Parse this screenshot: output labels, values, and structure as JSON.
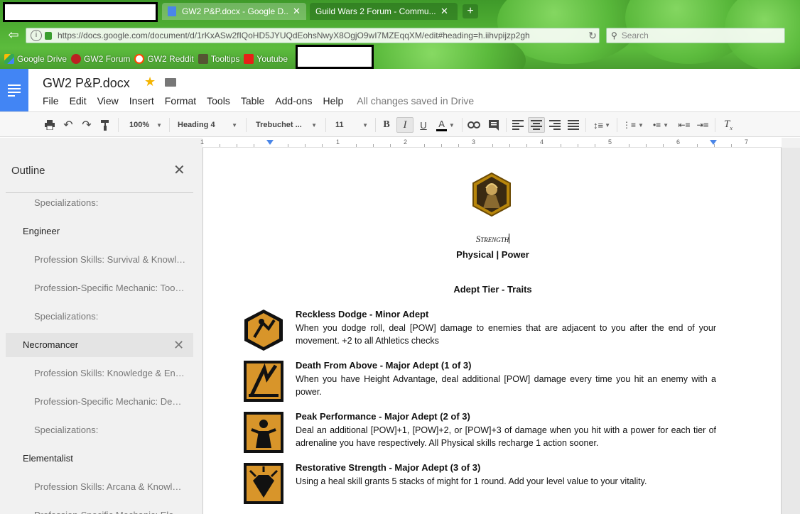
{
  "browser": {
    "tabs": [
      {
        "title": "GW2 P&P.docx - Google D...",
        "active": true
      },
      {
        "title": "Guild Wars 2 Forum - Commu...",
        "active": false
      }
    ],
    "new_tab_label": "+",
    "url": "https://docs.google.com/document/d/1rKxASw2fIQoHD5JYUQdEohsNwyX8OgjO9wI7MZEqqXM/edit#heading=h.iihvpijzp2gh",
    "search_placeholder": "Search",
    "bookmarks": [
      "Google Drive",
      "GW2 Forum",
      "GW2 Reddit",
      "Tooltips",
      "Youtube"
    ]
  },
  "docs": {
    "title": "GW2 P&P.docx",
    "menu": [
      "File",
      "Edit",
      "View",
      "Insert",
      "Format",
      "Tools",
      "Table",
      "Add-ons",
      "Help"
    ],
    "save_status": "All changes saved in Drive",
    "toolbar": {
      "zoom": "100%",
      "style": "Heading 4",
      "font": "Trebuchet ...",
      "size": "11"
    },
    "ruler_numbers": [
      "1",
      "1",
      "2",
      "3",
      "4",
      "5",
      "6",
      "7"
    ]
  },
  "outline": {
    "heading": "Outline",
    "items": [
      {
        "level": 2,
        "label": "Specializations:"
      },
      {
        "level": 1,
        "label": "Engineer"
      },
      {
        "level": 2,
        "label": "Profession Skills: Survival & Knowledge"
      },
      {
        "level": 2,
        "label": "Profession-Specific Mechanic: Toolbelt"
      },
      {
        "level": 2,
        "label": "Specializations:"
      },
      {
        "level": 1,
        "label": "Necromancer",
        "active": true
      },
      {
        "level": 2,
        "label": "Profession Skills: Knowledge & Endurance"
      },
      {
        "level": 2,
        "label": "Profession-Specific Mechanic: Death Shroud"
      },
      {
        "level": 2,
        "label": "Specializations:"
      },
      {
        "level": 1,
        "label": "Elementalist"
      },
      {
        "level": 2,
        "label": "Profession Skills: Arcana & Knowledge"
      },
      {
        "level": 2,
        "label": "Profession-Specific Mechanic: Elements"
      }
    ]
  },
  "document": {
    "section_title": "Strength",
    "subtitle": "Physical | Power",
    "tier_heading": "Adept Tier - Traits",
    "traits": [
      {
        "title": "Reckless Dodge - Minor Adept",
        "desc": "When you dodge roll, deal [POW] damage to enemies that are adjacent to you after the end of your movement. +2 to all Athletics checks"
      },
      {
        "title": "Death From Above - Major Adept (1 of 3)",
        "desc": "When you have Height Advantage, deal additional [POW] damage every time you hit an enemy with a power."
      },
      {
        "title": "Peak Performance - Major Adept (2 of 3)",
        "desc": "Deal an additional [POW]+1, [POW]+2, or [POW]+3 of damage when you hit with a power for each tier of adrenaline you have respectively. All Physical skills recharge 1 action sooner."
      },
      {
        "title": "Restorative Strength - Major Adept (3 of 3)",
        "desc": "Using a heal skill grants 5 stacks of might for 1 round. Add your level value to your vitality."
      }
    ]
  }
}
